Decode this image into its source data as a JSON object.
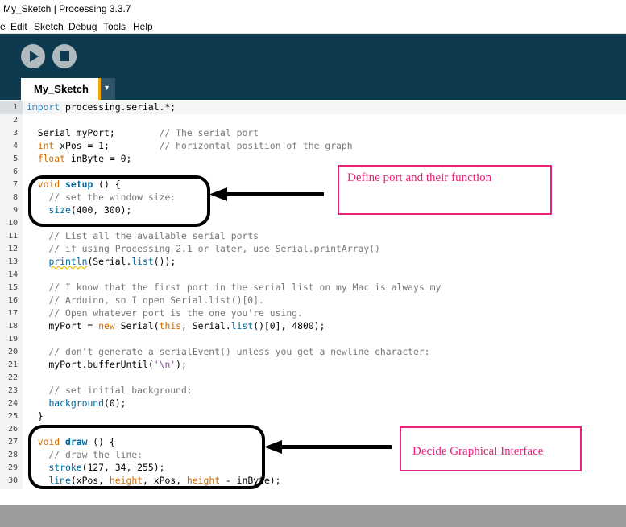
{
  "window": {
    "title": "My_Sketch | Processing 3.3.7"
  },
  "menu": [
    "e",
    "Edit",
    "Sketch",
    "Debug",
    "Tools",
    "Help"
  ],
  "toolbar": {
    "run": "run",
    "stop": "stop"
  },
  "tab": {
    "label": "My_Sketch",
    "menu_glyph": "▾"
  },
  "line_numbers": [
    "1",
    "2",
    "3",
    "4",
    "5",
    "6",
    "7",
    "8",
    "9",
    "10",
    "11",
    "12",
    "13",
    "14",
    "15",
    "16",
    "17",
    "18",
    "19",
    "20",
    "21",
    "22",
    "23",
    "24",
    "25",
    "26",
    "27",
    "28",
    "29",
    "30"
  ],
  "code": {
    "l1": [
      "import",
      " processing.serial.*;"
    ],
    "l3": [
      "  Serial myPort;        ",
      "// The serial port"
    ],
    "l4": [
      "  ",
      "int",
      " xPos = 1;         ",
      "// horizontal position of the graph"
    ],
    "l5": [
      "  ",
      "float",
      " inByte = 0;"
    ],
    "l7": [
      "  ",
      "void",
      " ",
      "setup",
      " () {"
    ],
    "l8": [
      "    // set the window size:"
    ],
    "l9": [
      "    ",
      "size",
      "(400, 300);"
    ],
    "l11": [
      "    // List all the available serial ports"
    ],
    "l12": [
      "    // if using Processing 2.1 or later, use Serial.printArray()"
    ],
    "l13": [
      "    ",
      "println",
      "(Serial.",
      "list",
      "());"
    ],
    "l15": [
      "    // I know that the first port in the serial list on my Mac is always my"
    ],
    "l16": [
      "    // Arduino, so I open Serial.list()[0]."
    ],
    "l17": [
      "    // Open whatever port is the one you're using."
    ],
    "l18": [
      "    myPort = ",
      "new",
      " Serial(",
      "this",
      ", Serial.",
      "list",
      "()[0], 4800);"
    ],
    "l20": [
      "    // don't generate a serialEvent() unless you get a newline character:"
    ],
    "l21": [
      "    myPort.bufferUntil(",
      "'\\n'",
      ");"
    ],
    "l23": [
      "    // set initial background:"
    ],
    "l24": [
      "    ",
      "background",
      "(0);"
    ],
    "l25": [
      "  }"
    ],
    "l27": [
      "  ",
      "void",
      " ",
      "draw",
      " () {"
    ],
    "l28": [
      "    // draw the line:"
    ],
    "l29": [
      "    ",
      "stroke",
      "(127, 34, 255);"
    ],
    "l30": [
      "    ",
      "line",
      "(xPos, ",
      "height",
      ", xPos, ",
      "height",
      " - inByte);"
    ]
  },
  "annotations": {
    "note1": "Define port and their function",
    "note2": "Decide Graphical Interface"
  },
  "colors": {
    "toolbar": "#0e3a4f",
    "tab_accent": "#f0a500",
    "annotation": "#e8217a"
  }
}
